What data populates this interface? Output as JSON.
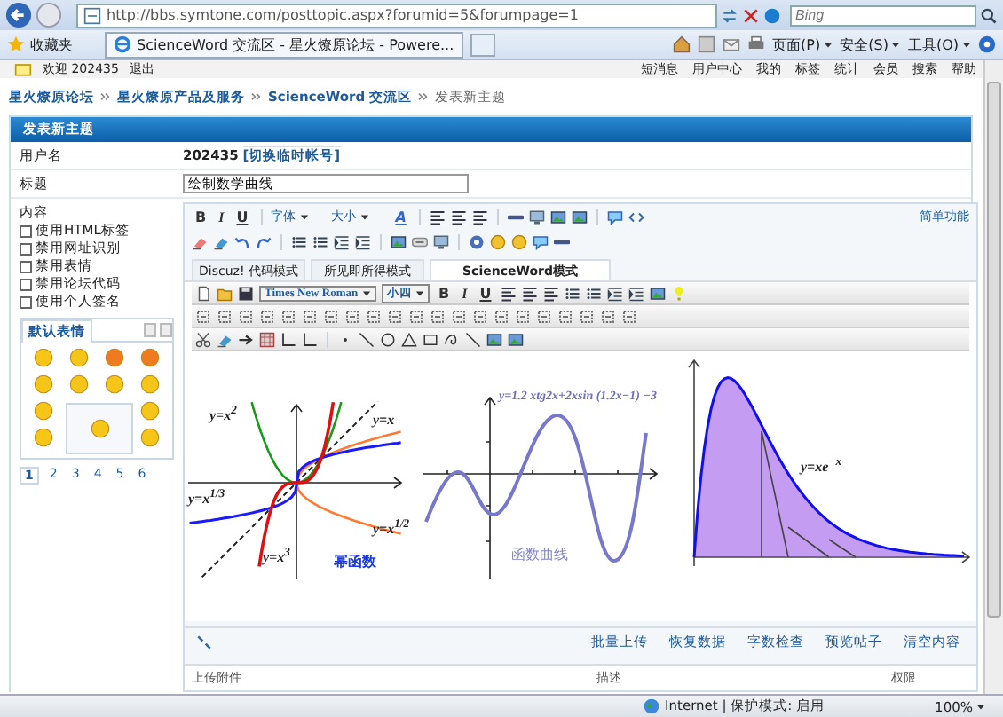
{
  "browser": {
    "address": "http://bbs.symtone.com/posttopic.aspx?forumid=5&forumpage=1",
    "search_placeholder": "Bing",
    "favorites": "收藏夹",
    "tab_title": "ScienceWord 交流区 - 星火燎原论坛 - Powere...",
    "commands": [
      "页面(P)",
      "安全(S)",
      "工具(O)"
    ]
  },
  "topbar": {
    "welcome": "欢迎 202435",
    "logout": "退出",
    "links": [
      "短消息",
      "用户中心",
      "我的",
      "标签",
      "统计",
      "会员",
      "搜索",
      "帮助"
    ]
  },
  "breadcrumb": [
    "星火燎原论坛",
    "星火燎原产品及服务",
    "ScienceWord 交流区",
    "发表新主题"
  ],
  "panel_title": "发表新主题",
  "form": {
    "username_label": "用户名",
    "username": "202435",
    "switch_link": "[切换临时帐号]",
    "title_label": "标题",
    "title_value": "绘制数学曲线",
    "content_label": "内容"
  },
  "options": [
    {
      "label": "使用HTML标签",
      "checked": false
    },
    {
      "label": "禁用网址识别",
      "checked": false
    },
    {
      "label": "禁用表情",
      "checked": false
    },
    {
      "label": "禁用论坛代码",
      "checked": false
    },
    {
      "label": "使用个人签名",
      "checked": false
    }
  ],
  "emoticons": {
    "tab": "默认表情",
    "pages": [
      {
        "label": "1",
        "selected": true
      },
      {
        "label": "2",
        "selected": false
      },
      {
        "label": "3",
        "selected": false
      },
      {
        "label": "4",
        "selected": false
      },
      {
        "label": "5",
        "selected": false
      },
      {
        "label": "6",
        "selected": false
      }
    ]
  },
  "editor": {
    "format_buttons": [
      "B",
      "I",
      "U"
    ],
    "font": "字体",
    "size": "大小",
    "color_button": "A",
    "simple_link": "简单功能",
    "modes": [
      {
        "label": "Discuz! 代码模式",
        "selected": false
      },
      {
        "label": "所见即所得模式",
        "selected": false
      },
      {
        "label": "ScienceWord模式",
        "selected": true
      }
    ],
    "font_select": "Times New Roman",
    "size_select": "小四",
    "sw_format_buttons": [
      "B",
      "I",
      "U"
    ]
  },
  "graphs": [
    {
      "kind": "power",
      "labels": [
        "y=x$^{2}$",
        "y=x",
        "y=x$^{1/3}$",
        "y=x$^{1/2}$",
        "y=x$^{3}$"
      ],
      "caption": "幂函数"
    },
    {
      "kind": "wave",
      "labels": [
        "y=1.2 xtg2x+2xsin (1.2x−1) −3"
      ],
      "caption": "函数曲线"
    },
    {
      "kind": "area",
      "labels": [
        "y=xe$^{−x}$"
      ]
    }
  ],
  "editor_actions": [
    "批量上传",
    "恢复数据",
    "字数检查",
    "预览帖子",
    "清空内容"
  ],
  "attachments": {
    "columns": [
      "上传附件",
      "描述",
      "权限"
    ]
  },
  "status": {
    "zone": "Internet | 保护模式: 启用",
    "zoom": "100%"
  }
}
